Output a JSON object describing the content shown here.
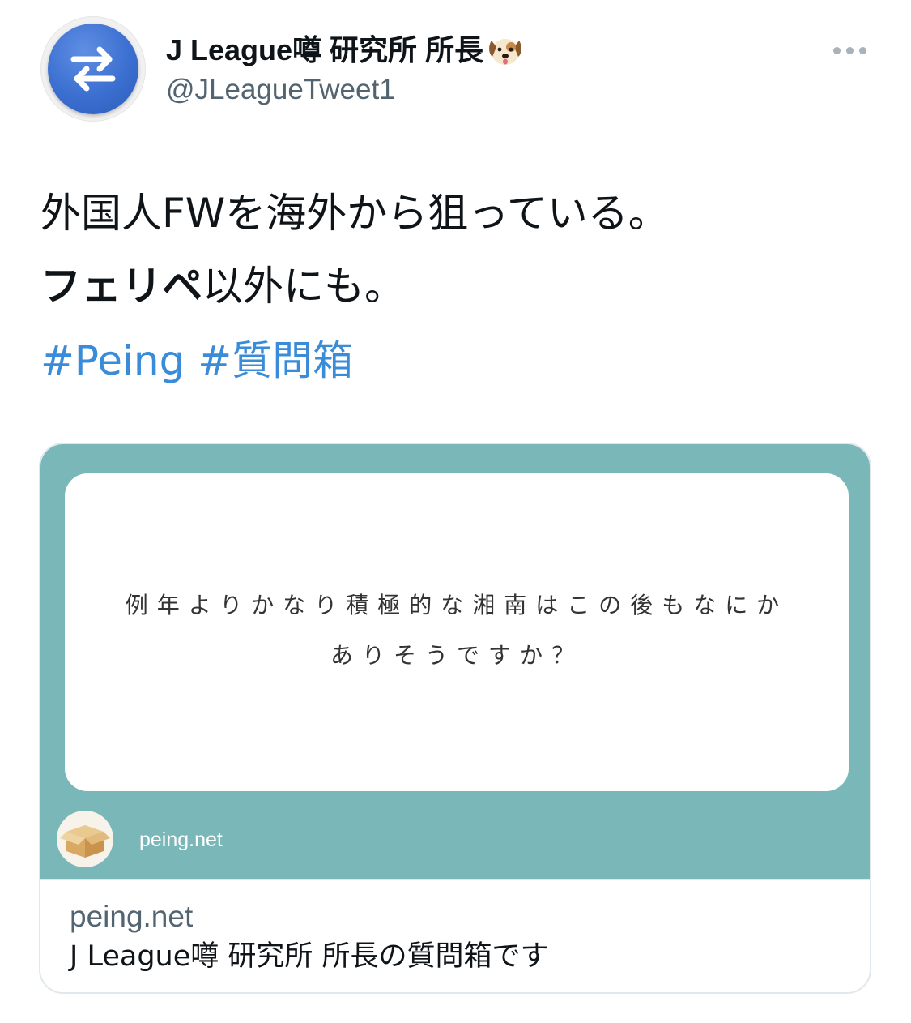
{
  "author": {
    "display_name": "J League噂 研究所 所長",
    "emoji_icon": "dog-face-icon",
    "handle": "@JLeagueTweet1",
    "avatar_icon": "arrows-swap-icon",
    "avatar_color": "#3b6fd0"
  },
  "more_icon": "ellipsis-icon",
  "tweet": {
    "line1": "外国人FWを海外から狙っている。",
    "line2_bold": "フェリペ",
    "line2_rest": "以外にも。",
    "hashtags": [
      "#Peing",
      "#質問箱"
    ]
  },
  "card": {
    "background_color": "#79b7b9",
    "question_line1": "例年よりかなり積極的な湘南はこの後もなにか",
    "question_line2": "ありそうですか？",
    "logo_icon": "cardboard-box-icon",
    "image_site_label": "peing.net",
    "domain": "peing.net",
    "title": "J League噂 研究所 所長の質問箱です"
  },
  "colors": {
    "hashtag": "#3a8bd8",
    "secondary_text": "#536471"
  }
}
